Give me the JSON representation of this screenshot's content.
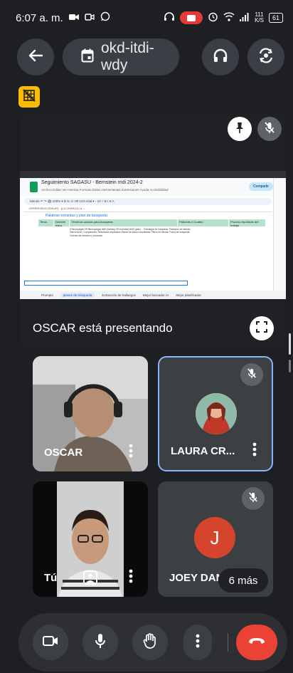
{
  "status_bar": {
    "time": "6:07 a. m.",
    "network_speed_value": "111",
    "network_speed_unit": "K/S",
    "battery": "61"
  },
  "header": {
    "meeting_code": "okd-itdi-wdy",
    "icons": [
      "back-arrow-icon",
      "calendar-icon",
      "headphones-icon",
      "switch-camera-icon"
    ]
  },
  "presentation": {
    "presenter_label": "OSCAR  está presentando",
    "sheet": {
      "title": "Seguimiento SAGASU - Bernstein mdi 2024-2",
      "menu": "Archivo  Editar  Ver  Insertar  Formato  Datos  Herramientas  Extensiones  Ayuda  Accesibilidad",
      "share": "Compartir",
      "toolbar": "Menús   ↶  ↷  🖨  100%  ▾  $  %  .0  .00  123   Arial  ▾  -  10  +   B  I  S  A",
      "formula": "=IFERROR(VLOOKUP(...)) & CHAR(10) & ...",
      "heading": "Palabras extraídas y plan de búsqueda",
      "col_headers": [
        "Tema",
        "Nombre extra",
        "Términos usados para búsqueda",
        "Patrones e Cuadro",
        "Proceso reportado del trabajo"
      ],
      "cells": "(Fibromyalgia OR fibromyalgia) AND (training OR exercise) AND (pain) ... Estrategia de búsqueda; Población de estudio; Intervención; Comparación; Resultados esperados; Bases de datos consultadas; Filtros de idioma; Fecha de búsqueda; Criterios de inclusión y exclusión",
      "tabs": [
        "Prompts",
        "planes de búsqueda",
        "Extracción de hallazgos",
        "Mejor buscador IA",
        "Mejor planificador"
      ]
    }
  },
  "participants": [
    {
      "name": "OSCAR",
      "muted": false
    },
    {
      "name": "LAURA CR...",
      "muted": true
    },
    {
      "name": "Tú",
      "muted": false
    },
    {
      "name": "JOEY DAN",
      "initial": "J",
      "muted": true
    }
  ],
  "more_people": "6 más",
  "controls": {
    "items": [
      "camera-icon",
      "mic-icon",
      "raise-hand-icon",
      "more-options-icon",
      "end-call-icon"
    ]
  },
  "colors": {
    "background": "#1e1f22",
    "end_call": "#ea4335",
    "accent_yellow": "#fbbc04",
    "tile_border": "#8ab4f8",
    "avatar_j": "#d5452d"
  }
}
